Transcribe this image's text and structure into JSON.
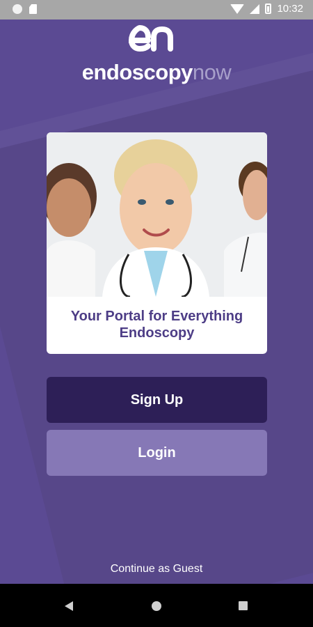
{
  "status_bar": {
    "time": "10:32"
  },
  "brand": {
    "name_main": "endoscopy",
    "name_suffix": "now",
    "mark_text": "en"
  },
  "hero": {
    "caption": "Your Portal for Everything Endoscopy"
  },
  "actions": {
    "signup_label": "Sign Up",
    "login_label": "Login",
    "guest_label": "Continue as Guest"
  },
  "colors": {
    "background": "#5b4a93",
    "signup_button": "#2d1f57",
    "login_button": "#8678b6",
    "caption_text": "#4d3d86"
  },
  "icons": [
    "circle-icon",
    "sd-card-icon",
    "wifi-icon",
    "signal-icon",
    "battery-icon",
    "back-icon",
    "home-icon",
    "recents-icon"
  ]
}
